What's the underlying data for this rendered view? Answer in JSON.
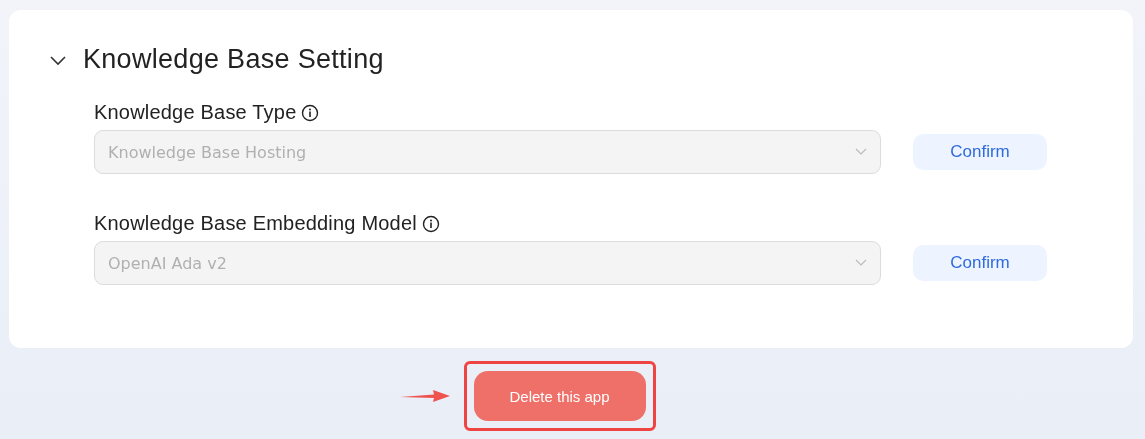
{
  "section": {
    "title": "Knowledge Base Setting",
    "expanded": true
  },
  "fields": [
    {
      "label": "Knowledge Base Type",
      "value": "Knowledge Base Hosting",
      "disabled": true,
      "button": "Confirm"
    },
    {
      "label": "Knowledge Base Embedding Model",
      "value": "OpenAI Ada v2",
      "disabled": true,
      "button": "Confirm"
    }
  ],
  "delete_button": {
    "label": "Delete this app",
    "highlighted": true
  }
}
